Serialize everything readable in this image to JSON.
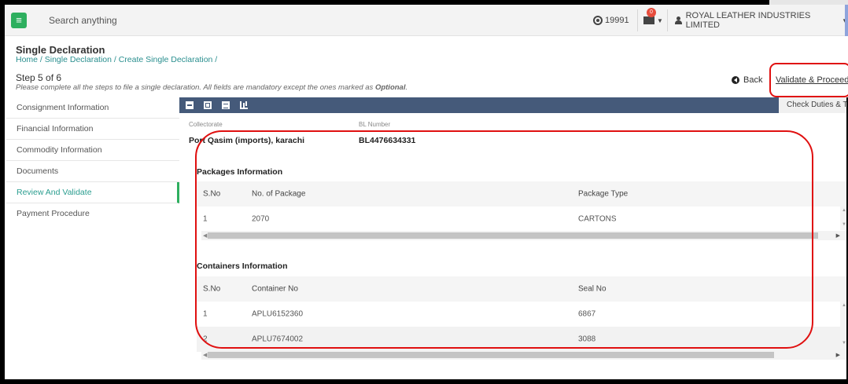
{
  "topbar": {
    "search_placeholder": "Search anything",
    "count": "19991",
    "notification_count": "0",
    "company": "ROYAL LEATHER INDUSTRIES LIMITED"
  },
  "page": {
    "title": "Single Declaration",
    "breadcrumb": "Home / Single Declaration / Create Single Declaration /",
    "step": "Step 5 of 6",
    "note_prefix": "Please complete all the steps to file a single declaration. All fields are mandatory except the ones marked as ",
    "note_optional": "Optional",
    "note_suffix": "."
  },
  "actions": {
    "back": "Back",
    "validate": "Validate & Proceed",
    "check_duties": "Check Duties & Taxes"
  },
  "sidebar": {
    "items": [
      {
        "label": "Consignment Information"
      },
      {
        "label": "Financial Information"
      },
      {
        "label": "Commodity Information"
      },
      {
        "label": "Documents"
      },
      {
        "label": "Review And Validate"
      },
      {
        "label": "Payment Procedure"
      }
    ]
  },
  "meta": {
    "collectorate_label": "Collectorate",
    "collectorate_value": "Port Qasim (imports), karachi",
    "bl_label": "BL Number",
    "bl_value": "BL4476634331"
  },
  "packages": {
    "title": "Packages Information",
    "headers": [
      "S.No",
      "No. of Package",
      "Package Type"
    ],
    "rows": [
      {
        "sno": "1",
        "count": "2070",
        "type": "CARTONS"
      }
    ]
  },
  "containers": {
    "title": "Containers Information",
    "headers": [
      "S.No",
      "Container No",
      "Seal No"
    ],
    "rows": [
      {
        "sno": "1",
        "number": "APLU6152360",
        "seal": "6867"
      },
      {
        "sno": "2",
        "number": "APLU7674002",
        "seal": "3088"
      }
    ]
  },
  "colors": {
    "accent_green": "#2eaf5f",
    "toolbar_blue": "#455a7a",
    "highlight_red": "#e01010",
    "link_teal": "#2a8f8f"
  }
}
